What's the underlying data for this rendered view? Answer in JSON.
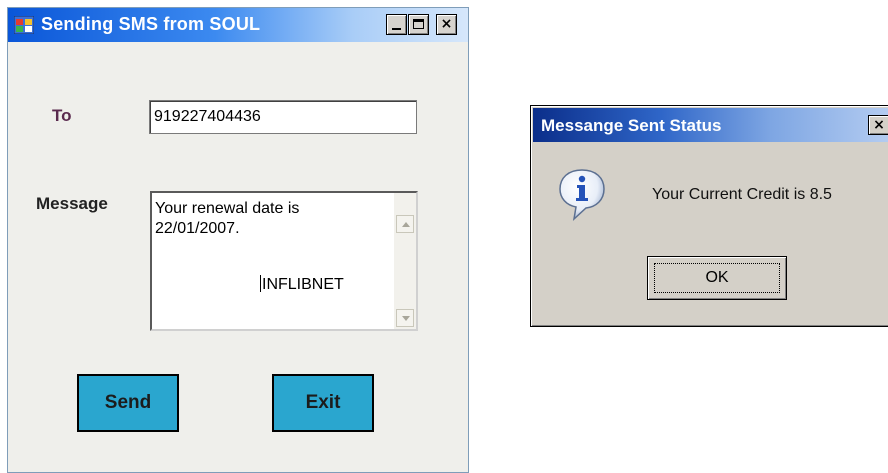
{
  "main_window": {
    "title": "Sending SMS from SOUL",
    "icon": "app-form-icon",
    "controls": {
      "minimize": "minimize-icon",
      "maximize": "maximize-icon",
      "close": "×"
    },
    "to_label": "To",
    "to_value": "919227404436",
    "message_label": "Message",
    "message_text": "Your renewal date is\n22/01/2007.",
    "message_signature": "INFLIBNET",
    "send_label": "Send",
    "exit_label": "Exit",
    "button_color": "#2aa6cf"
  },
  "dialog": {
    "title": "Messange Sent Status",
    "icon": "info-icon",
    "message": "Your Current Credit is 8.5",
    "ok_label": "OK",
    "close": "×"
  },
  "colors": {
    "titlebar_active": "#0a56d8",
    "dialog_titlebar": "#0b2e8a",
    "window_face": "#efefeb",
    "dialog_face": "#d4d0c8"
  }
}
